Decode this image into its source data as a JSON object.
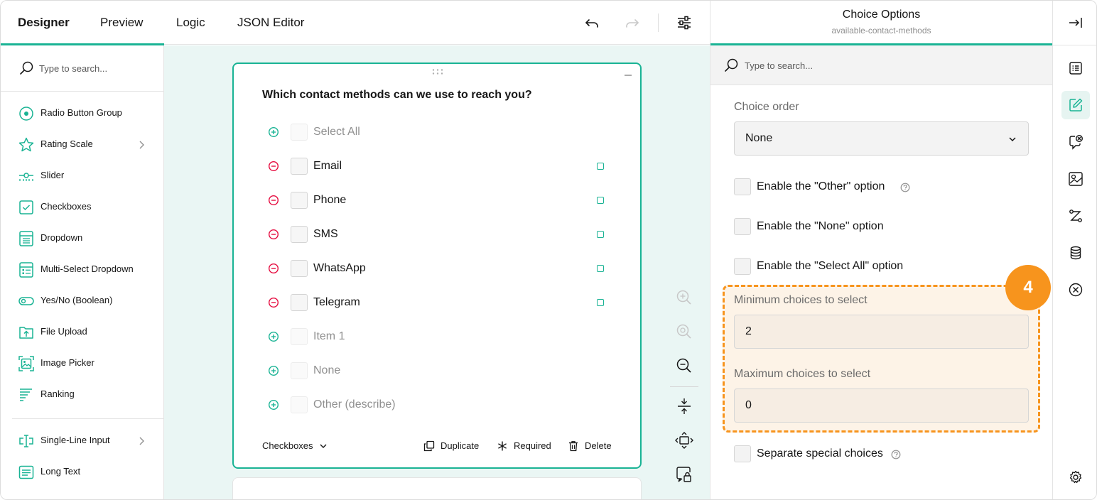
{
  "tabs": [
    {
      "label": "Designer",
      "active": true
    },
    {
      "label": "Preview",
      "active": false
    },
    {
      "label": "Logic",
      "active": false
    },
    {
      "label": "JSON Editor",
      "active": false
    }
  ],
  "toolbox": {
    "search_placeholder": "Type to search...",
    "items": [
      {
        "label": "Radio Button Group",
        "icon": "radio-icon"
      },
      {
        "label": "Rating Scale",
        "icon": "star-icon",
        "has_submenu": true
      },
      {
        "label": "Slider",
        "icon": "slider-icon"
      },
      {
        "label": "Checkboxes",
        "icon": "checkbox-icon"
      },
      {
        "label": "Dropdown",
        "icon": "dropdown-icon"
      },
      {
        "label": "Multi-Select Dropdown",
        "icon": "multiselect-icon"
      },
      {
        "label": "Yes/No (Boolean)",
        "icon": "toggle-icon"
      },
      {
        "label": "File Upload",
        "icon": "file-upload-icon"
      },
      {
        "label": "Image Picker",
        "icon": "image-picker-icon"
      },
      {
        "label": "Ranking",
        "icon": "ranking-icon"
      },
      {
        "label": "Single-Line Input",
        "icon": "text-input-icon",
        "has_submenu": true
      },
      {
        "label": "Long Text",
        "icon": "long-text-icon"
      }
    ]
  },
  "question": {
    "title": "Which contact methods can we use to reach you?",
    "choices": [
      {
        "label": "Select All",
        "kind": "add"
      },
      {
        "label": "Email",
        "kind": "remove"
      },
      {
        "label": "Phone",
        "kind": "remove"
      },
      {
        "label": "SMS",
        "kind": "remove"
      },
      {
        "label": "WhatsApp",
        "kind": "remove"
      },
      {
        "label": "Telegram",
        "kind": "remove"
      },
      {
        "label": "Item 1",
        "kind": "add"
      },
      {
        "label": "None",
        "kind": "add"
      },
      {
        "label": "Other (describe)",
        "kind": "add"
      }
    ],
    "footer": {
      "type_label": "Checkboxes",
      "duplicate_label": "Duplicate",
      "required_label": "Required",
      "delete_label": "Delete"
    }
  },
  "properties": {
    "title": "Choice Options",
    "subtitle": "available-contact-methods",
    "search_placeholder": "Type to search...",
    "choice_order_label": "Choice order",
    "choice_order_value": "None",
    "enable_other_label": "Enable the \"Other\" option",
    "enable_none_label": "Enable the \"None\" option",
    "enable_select_all_label": "Enable the \"Select All\" option",
    "min_choices_label": "Minimum choices to select",
    "min_choices_value": "2",
    "max_choices_label": "Maximum choices to select",
    "max_choices_value": "0",
    "separate_special_label": "Separate special choices",
    "step_badge": "4"
  },
  "colors": {
    "accent": "#19b394",
    "remove": "#e50a3e",
    "highlight": "#f7941d"
  }
}
